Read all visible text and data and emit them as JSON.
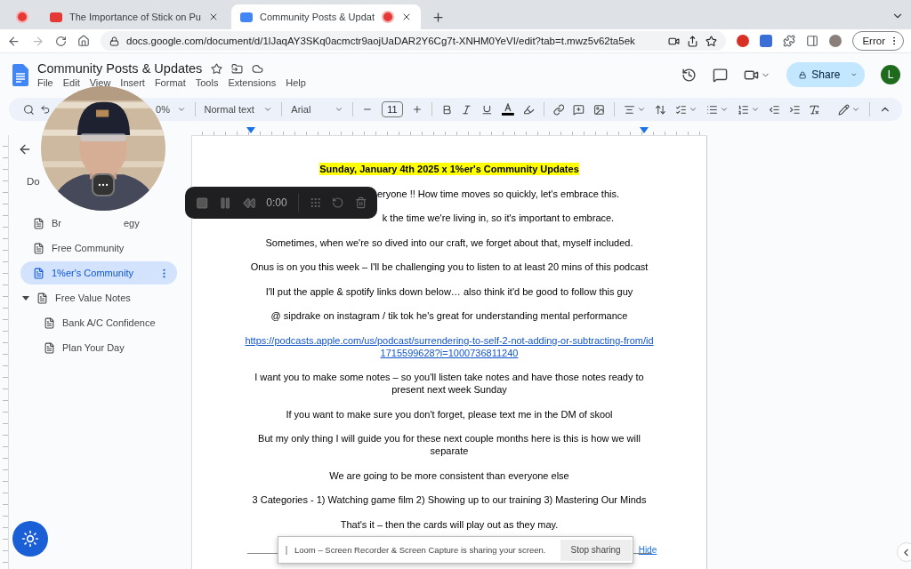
{
  "browser": {
    "tabs": [
      {
        "kind": "pinned",
        "selected": false
      },
      {
        "kind": "video",
        "title": "The Importance of Stick on Pu",
        "selected": false
      },
      {
        "kind": "document",
        "title": "Community Posts & Updat",
        "selected": true
      }
    ],
    "url": "docs.google.com/document/d/1lJaqAY3SKq0acmctr9aojUaDAR2Y6Cg7t-XNHM0YeVI/edit?tab=t.mwz5v62ta5ek",
    "profile_button": "Error"
  },
  "doc_header": {
    "title": "Community Posts & Updates",
    "menus": [
      "File",
      "Edit",
      "View",
      "Insert",
      "Format",
      "Tools",
      "Extensions",
      "Help"
    ],
    "share": "Share",
    "avatar": "L"
  },
  "toolbar": {
    "zoom": "0%",
    "style": "Normal text",
    "font": "Arial",
    "font_size": "11"
  },
  "sidebar": {
    "heading": "Do",
    "items": [
      {
        "label": "Br",
        "label_end": "egy",
        "selected": false
      },
      {
        "label": "Free Community",
        "selected": false
      },
      {
        "label": "1%er's Community",
        "selected": true
      },
      {
        "label": "Free Value Notes",
        "selected": false,
        "expanded": true,
        "children": [
          {
            "label": "Bank A/C Confidence",
            "selected": false
          },
          {
            "label": "Plan Your Day",
            "selected": false
          }
        ]
      }
    ]
  },
  "document": {
    "paragraphs": [
      {
        "kind": "heading",
        "text": "Sunday, January 4th 2025 x 1%er's Community Updates"
      },
      {
        "kind": "partial",
        "text": "eryone !! How time moves so quickly, let's embrace this."
      },
      {
        "kind": "partial",
        "text": "k the time we're living in, so it's important to embrace."
      },
      {
        "kind": "text",
        "text": "Sometimes, when we're so dived into our craft, we forget about that, myself included."
      },
      {
        "kind": "text",
        "text": "Onus is on you this week – I'll be challenging you to listen to at least 20 mins of this podcast"
      },
      {
        "kind": "text",
        "text": "I'll put the apple & spotify links down below… also think it'd be good to follow this guy"
      },
      {
        "kind": "text",
        "text": "@ sipdrake on instagram / tik tok he's great for understanding mental performance"
      },
      {
        "kind": "link",
        "text": "https://podcasts.apple.com/us/podcast/surrendering-to-self-2-not-adding-or-subtracting-from/id1715599628?i=1000736811240"
      },
      {
        "kind": "text",
        "text": "I want you to make some notes – so you'll listen take notes and have those notes ready to present next week Sunday"
      },
      {
        "kind": "text",
        "text": "If you want to make sure you don't forget, please text me in the DM of skool"
      },
      {
        "kind": "text",
        "text": "But my only thing I will guide you for these next couple months here is this is how we will separate"
      },
      {
        "kind": "text",
        "text": "We are going to be more consistent than everyone else"
      },
      {
        "kind": "text",
        "text": "3 Categories - 1) Watching game film 2) Showing up to our training 3) Mastering Our Minds"
      },
      {
        "kind": "text",
        "text": "That's it – then the cards will play out as they may."
      },
      {
        "kind": "rule"
      }
    ]
  },
  "recorder": {
    "time": "0:00"
  },
  "share_notice": {
    "message": "Loom – Screen Recorder & Screen Capture is sharing your screen.",
    "stop": "Stop sharing",
    "hide": "Hide"
  }
}
